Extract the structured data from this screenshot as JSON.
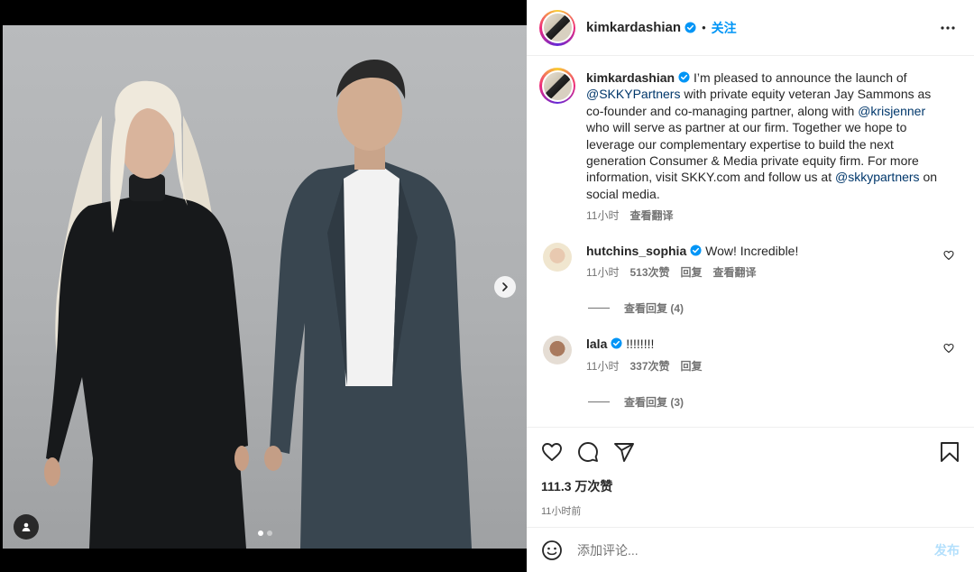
{
  "post": {
    "author": "kimkardashian",
    "separator": "•",
    "follow_label": "关注",
    "photo_count": 2,
    "active_photo": 1
  },
  "caption": {
    "user": "kimkardashian",
    "text_1": "I’m pleased to announce the launch of ",
    "mention_1": "@SKKYPartners",
    "text_2": " with private equity veteran Jay Sammons as co-founder and co-managing partner, along with ",
    "mention_2": "@krisjenner",
    "text_3": " who will serve as partner at our firm. Together we hope to leverage our complementary expertise to build the next generation Consumer & Media private equity firm. For more information, visit SKKY.com and follow us at ",
    "mention_3": "@skkypartners",
    "text_4": " on social media.",
    "time": "11小时",
    "translate": "查看翻译"
  },
  "comments": [
    {
      "user": "hutchins_sophia",
      "text": "Wow! Incredible!",
      "time": "11小时",
      "likes": "513次赞",
      "reply": "回复",
      "translate": "查看翻译",
      "view_replies": "查看回复 (4)"
    },
    {
      "user": "lala",
      "text": "!!!!!!!!",
      "time": "11小时",
      "likes": "337次赞",
      "reply": "回复",
      "view_replies": "查看回复 (3)"
    }
  ],
  "stats": {
    "likes": "111.3 万次赞",
    "time": "11小时前"
  },
  "composer": {
    "placeholder": "添加评论...",
    "post_label": "发布"
  },
  "colors": {
    "accent": "#0095f6",
    "mention": "#00376b",
    "muted": "#737373",
    "post_disabled": "#b2dffc"
  },
  "icons": {
    "verified": "verified-badge-icon",
    "more": "more-options-icon",
    "like": "heart-icon",
    "comment": "comment-icon",
    "share": "share-icon",
    "save": "bookmark-icon",
    "emoji": "emoji-icon",
    "next": "chevron-right-icon",
    "tag": "user-tag-icon"
  }
}
